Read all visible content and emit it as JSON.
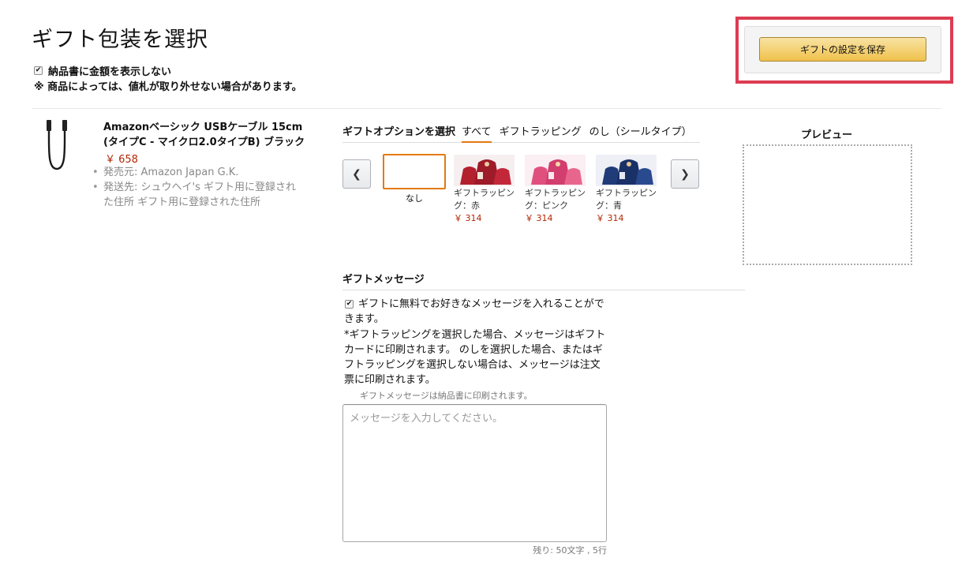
{
  "header": {
    "title": "ギフト包装を選択",
    "hide_price_label": "納品書に金額を表示しない",
    "note": "※ 商品によっては、値札が取り外せない場合があります。",
    "save_button": "ギフトの設定を保存"
  },
  "product": {
    "name": "Amazonベーシック USBケーブル 15cm (タイプC - マイクロ2.0タイプB) ブラック",
    "price": "￥ 658",
    "seller": "発売元: Amazon Japan G.K.",
    "ship_to": "発送先: シュウヘイ's ギフト用に登録された住所 ギフト用に登録された住所"
  },
  "gift_options": {
    "label": "ギフトオプションを選択",
    "tabs": [
      "すべて",
      "ギフトラッピング",
      "のし（シールタイプ）"
    ],
    "active_tab": "すべて",
    "none_label": "なし",
    "items": [
      {
        "name": "ギフトラッピング：赤",
        "price": "￥ 314",
        "color": "#b3202e"
      },
      {
        "name": "ギフトラッピング：ピンク",
        "price": "￥ 314",
        "color": "#e0507e"
      },
      {
        "name": "ギフトラッピング：青",
        "price": "￥ 314",
        "color": "#1f3b78"
      }
    ]
  },
  "preview": {
    "label": "プレビュー"
  },
  "message": {
    "heading": "ギフトメッセージ",
    "free_message_label": "ギフトに無料でお好きなメッセージを入れることができます。",
    "detail": "*ギフトラッピングを選択した場合、メッセージはギフトカードに印刷されます。 のしを選択した場合、またはギフトラッピングを選択しない場合は、メッセージは注文票に印刷されます。",
    "printed_note": "ギフトメッセージは納品書に印刷されます。",
    "placeholder": "メッセージを入力してください。",
    "remaining": "残り: 50文字 , 5行"
  },
  "colors": {
    "accent_orange": "#e47911",
    "price_red": "#b12704",
    "highlight_red": "#dc3c52",
    "button_yellow": "#f0c14b"
  }
}
